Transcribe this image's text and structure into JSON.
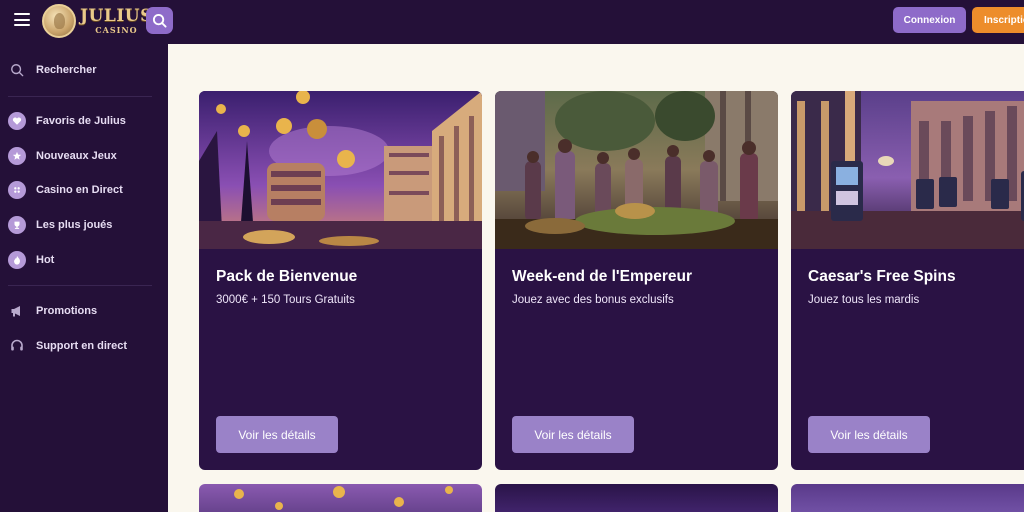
{
  "header": {
    "logo_main": "JULIUS",
    "logo_sub": "CASINO",
    "login_label": "Connexion",
    "signup_label": "Inscription"
  },
  "sidebar": {
    "search_label": "Rechercher",
    "items": [
      {
        "label": "Favoris de Julius",
        "icon": "heart-icon"
      },
      {
        "label": "Nouveaux Jeux",
        "icon": "star-icon"
      },
      {
        "label": "Casino en Direct",
        "icon": "live-casino-icon"
      },
      {
        "label": "Les plus joués",
        "icon": "trophy-icon"
      },
      {
        "label": "Hot",
        "icon": "flame-icon"
      }
    ],
    "extras": [
      {
        "label": "Promotions",
        "icon": "megaphone-icon"
      },
      {
        "label": "Support en direct",
        "icon": "headset-icon"
      }
    ]
  },
  "promos": [
    {
      "title": "Pack de Bienvenue",
      "subtitle": "3000€ + 150 Tours Gratuits",
      "button": "Voir les détails"
    },
    {
      "title": "Week-end de l'Empereur",
      "subtitle": "Jouez avec des bonus exclusifs",
      "button": "Voir les détails"
    },
    {
      "title": "Caesar's Free Spins",
      "subtitle": "Jouez tous les mardis",
      "button": "Voir les détails"
    }
  ],
  "colors": {
    "background": "#241038",
    "card": "#2a1244",
    "accent_purple": "#8e6bc9",
    "accent_orange": "#ed8d2b",
    "content_bg": "#faf7ee"
  }
}
